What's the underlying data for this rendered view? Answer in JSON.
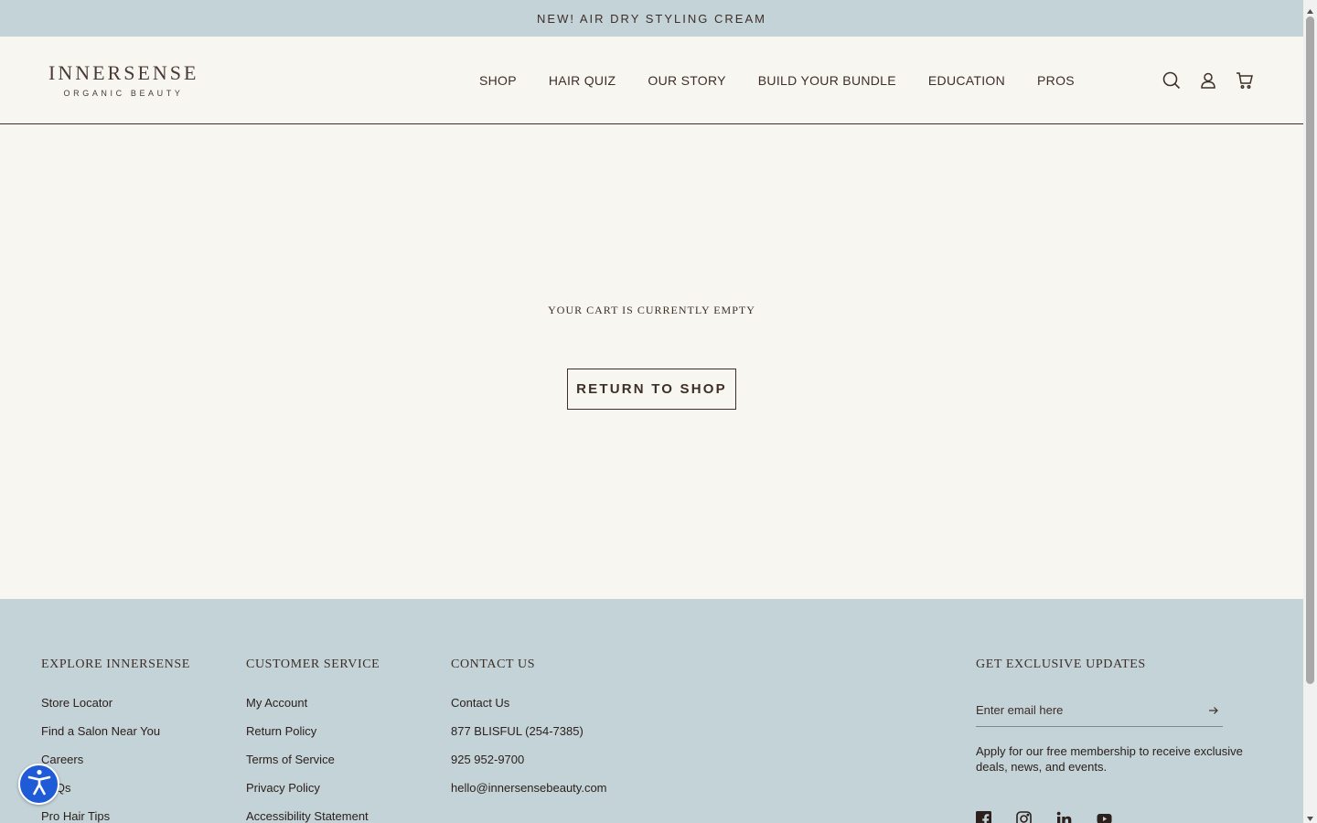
{
  "announcement": {
    "text": "NEW! AIR DRY STYLING CREAM"
  },
  "header": {
    "logo": {
      "name": "INNERSENSE",
      "tagline": "ORGANIC BEAUTY"
    },
    "nav": [
      "SHOP",
      "HAIR QUIZ",
      "OUR STORY",
      "BUILD YOUR BUNDLE",
      "EDUCATION",
      "PROS"
    ],
    "icons": [
      "search-icon",
      "account-icon",
      "cart-icon"
    ]
  },
  "cart": {
    "empty_message": "YOUR CART IS CURRENTLY EMPTY",
    "return_button": "RETURN TO SHOP"
  },
  "footer": {
    "explore": {
      "heading": "EXPLORE INNERSENSE",
      "links": [
        "Store Locator",
        "Find a Salon Near You",
        "Careers",
        "FAQs",
        "Pro Hair Tips"
      ]
    },
    "customer_service": {
      "heading": "CUSTOMER SERVICE",
      "links": [
        "My Account",
        "Return Policy",
        "Terms of Service",
        "Privacy Policy",
        "Accessibility Statement"
      ]
    },
    "contact": {
      "heading": "CONTACT US",
      "links": [
        "Contact Us",
        "877 BLISFUL (254-7385)",
        "925 952-9700",
        "hello@innersensebeauty.com"
      ]
    },
    "updates": {
      "heading": "GET EXCLUSIVE UPDATES",
      "email_placeholder": "Enter email here",
      "note": "Apply for our free membership to receive exclusive deals, news, and events.",
      "socials": [
        "facebook-icon",
        "instagram-icon",
        "linkedin-icon",
        "youtube-icon"
      ]
    }
  },
  "colors": {
    "background": "#f8f6f1",
    "accent_blue": "#c3d3d8",
    "text": "#3d2e28",
    "a11y_button": "#1f5bd6"
  }
}
